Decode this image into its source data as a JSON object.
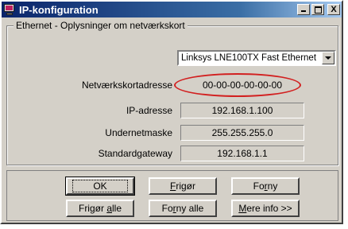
{
  "window": {
    "title": "IP-konfiguration",
    "controls": {
      "minimize": "_",
      "maximize": "□",
      "close": "X"
    }
  },
  "group": {
    "title": "Ethernet - Oplysninger om netværkskort",
    "adapter_selected": "Linksys LNE100TX Fast Ethernet",
    "rows": [
      {
        "label": "Netværkskortadresse",
        "value": "00-00-00-00-00-00",
        "highlighted": true
      },
      {
        "label": "IP-adresse",
        "value": "192.168.1.100"
      },
      {
        "label": "Undernetmaske",
        "value": "255.255.255.0"
      },
      {
        "label": "Standardgateway",
        "value": "192.168.1.1"
      }
    ]
  },
  "buttons": {
    "ok": "OK",
    "release_pre": "",
    "release_mn": "F",
    "release_post": "rigør",
    "renew_pre": "Fo",
    "renew_mn": "r",
    "renew_post": "ny",
    "release_all_pre": "Frigør ",
    "release_all_mn": "a",
    "release_all_post": "lle",
    "renew_all_pre": "Fo",
    "renew_all_mn": "r",
    "renew_all_post": "ny alle",
    "more_info_pre": "",
    "more_info_mn": "M",
    "more_info_post": "ere info >>"
  },
  "colors": {
    "titlebar_start": "#0a246a",
    "titlebar_end": "#a6caf0",
    "face": "#d4d0c8",
    "highlight_ring": "#d22020"
  },
  "icons": {
    "app": "network-config-icon",
    "combo_arrow": "chevron-down-icon"
  }
}
